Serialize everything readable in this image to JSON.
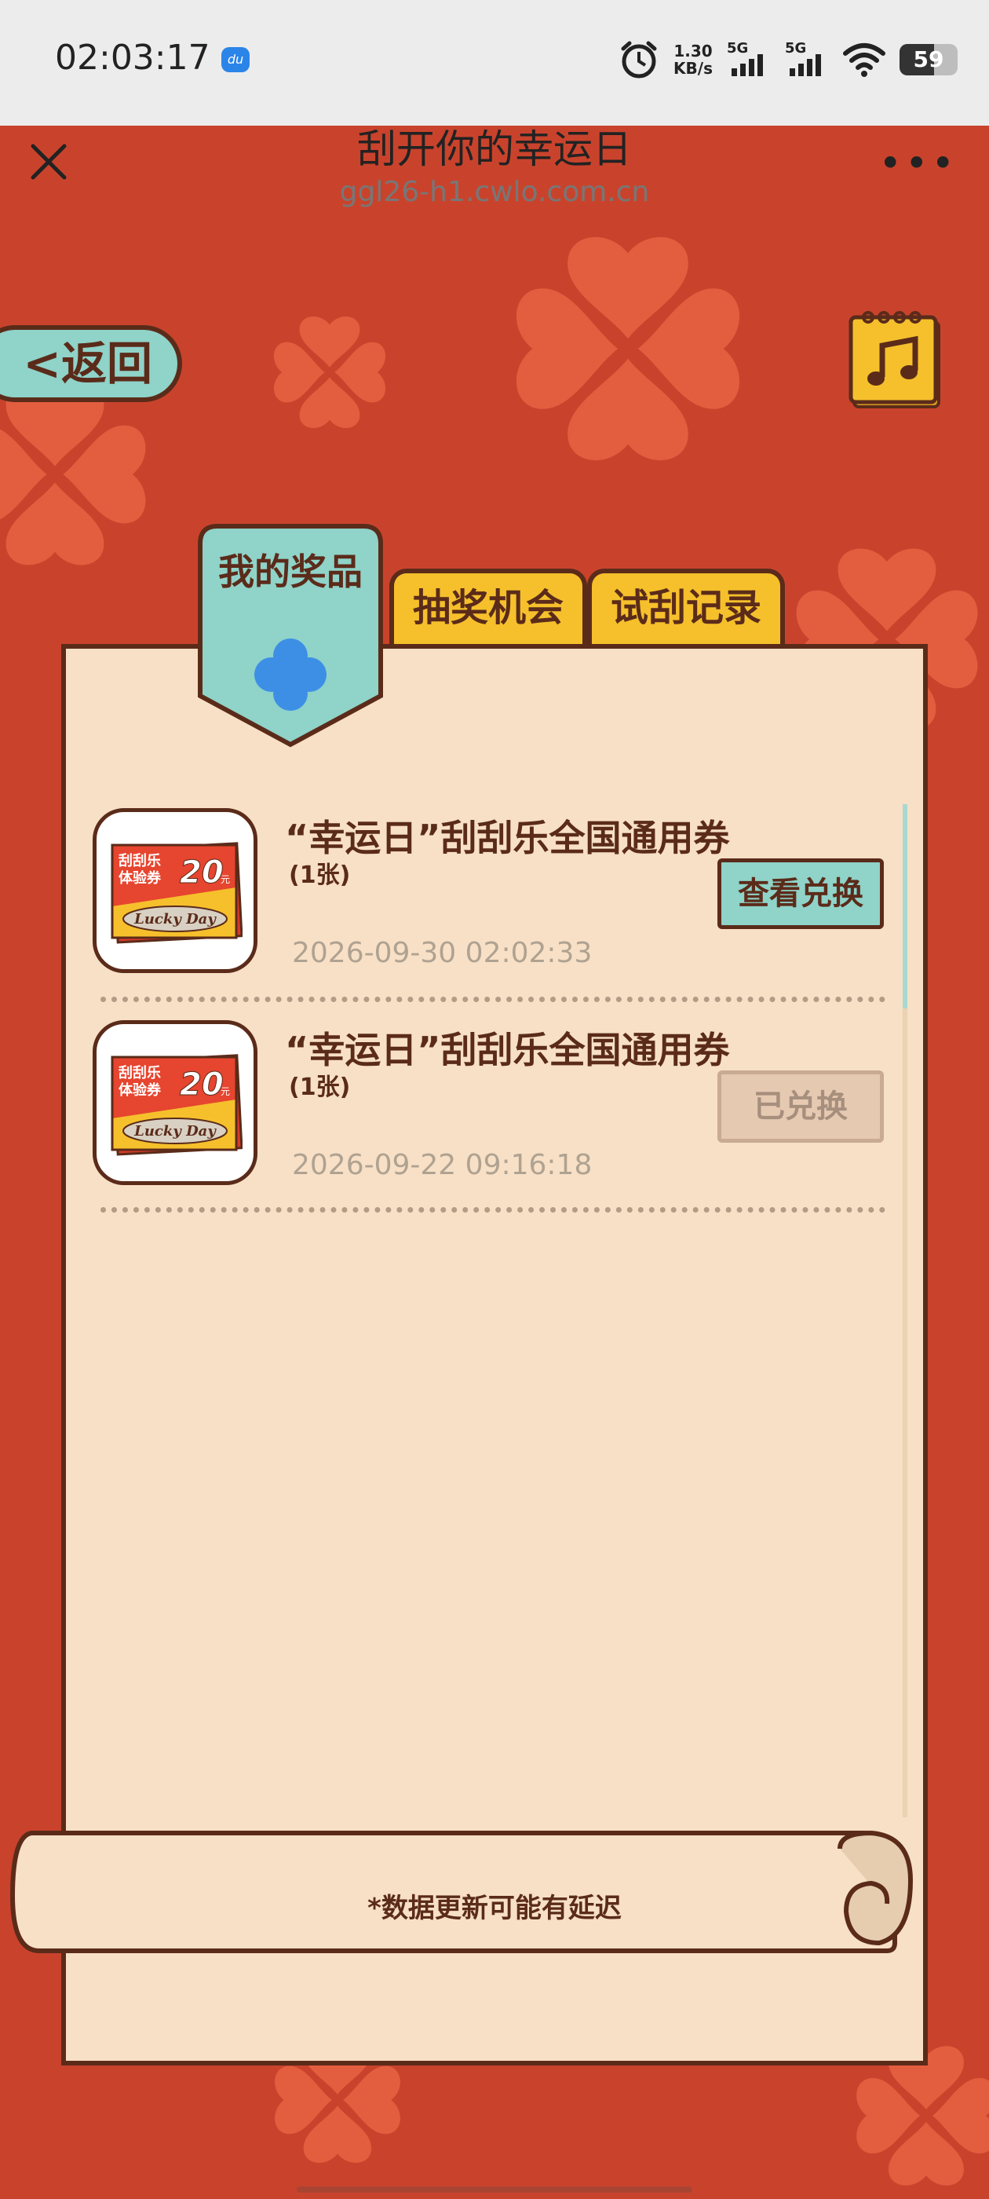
{
  "status_bar": {
    "time": "02:03:17",
    "app_badge": "du",
    "net_speed_value": "1.30",
    "net_speed_unit": "KB/s",
    "sim1": "5G",
    "sim2": "5G",
    "battery": "59"
  },
  "nav": {
    "title": "刮开你的幸运日",
    "url": "ggl26-h1.cwlo.com.cn"
  },
  "header": {
    "back_label": "<返回"
  },
  "tabs": [
    {
      "label": "我的奖品",
      "active": true
    },
    {
      "label": "抽奖机会",
      "active": false
    },
    {
      "label": "试刮记录",
      "active": false
    }
  ],
  "prizes": [
    {
      "name": "“幸运日”刮刮乐全国通用券",
      "qty": "(1张)",
      "date": "2026-09-30 02:02:33",
      "action": "查看兑换",
      "redeemed": false,
      "ticket": {
        "line1": "刮刮乐",
        "line2": "体验券",
        "amount": "20",
        "unit": "元",
        "brand": "Lucky Day"
      }
    },
    {
      "name": "“幸运日”刮刮乐全国通用券",
      "qty": "(1张)",
      "date": "2026-09-22 09:16:18",
      "action": "已兑换",
      "redeemed": true,
      "ticket": {
        "line1": "刮刮乐",
        "line2": "体验券",
        "amount": "20",
        "unit": "元",
        "brand": "Lucky Day"
      }
    }
  ],
  "footer": {
    "note": "*数据更新可能有延迟"
  },
  "colors": {
    "background": "#c9432c",
    "panel": "#f7e0c6",
    "outline": "#5b2b1a",
    "teal": "#8fd3c9",
    "yellow": "#f5c02b",
    "clover_blue": "#3d8fe6"
  }
}
